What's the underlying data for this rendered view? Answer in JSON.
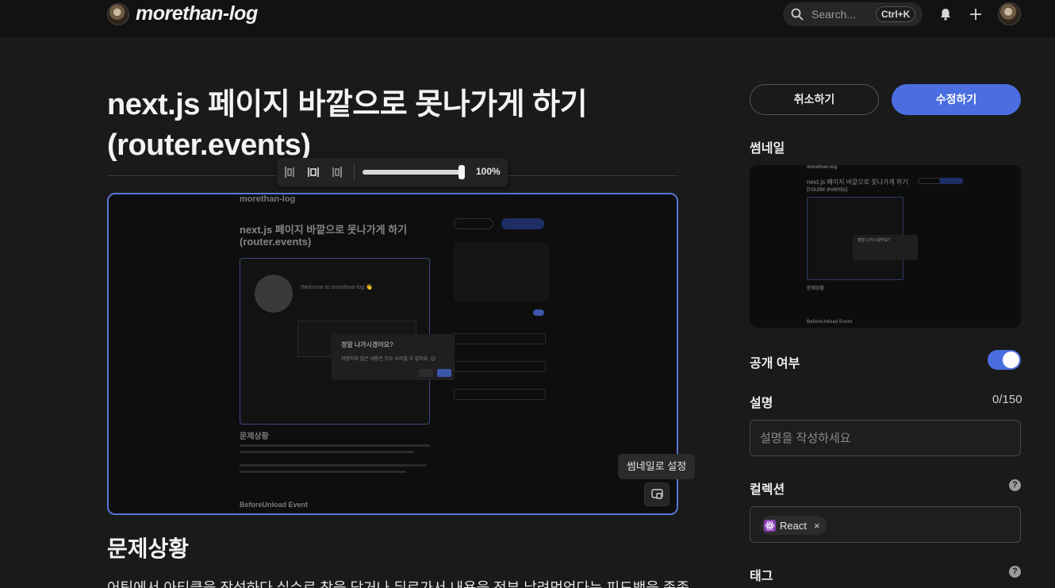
{
  "header": {
    "site_name": "morethan-log",
    "search_placeholder": "Search...",
    "search_shortcut": "Ctrl+K"
  },
  "post": {
    "title": "next.js 페이지 바깥으로 못나가게 하기 (router.events)",
    "section_heading": "문제상황",
    "body_first_line": "어팀에서 아티클을 작성하다 실수로 창을 닫거나 뒤로가서 내용을 전부 날려먹었다는 피드백을 종종"
  },
  "image_toolbar": {
    "zoom_label": "100%",
    "zoom_level": 1.0
  },
  "image_actions": {
    "thumbnail_tooltip": "썸네일로 설정"
  },
  "screenshot_inner": {
    "site_name": "morethan-log",
    "title_line1": "next.js 페이지 바깥으로 못나가게 하기",
    "title_line2": "(router.events)",
    "cancel": "취소하기",
    "edit": "수정하기",
    "dialog_title": "정말 나가시겠어요?",
    "dialog_text": "저장하지 않은 내용은 모두 사라질 수 있어요. 😊",
    "dialog_cancel": "취소",
    "dialog_ok": "확인",
    "section": "문제상황",
    "subsection": "BeforeUnload Event",
    "welcome": "Welcome to morethan-log 👋"
  },
  "sidebar": {
    "cancel_label": "취소하기",
    "edit_label": "수정하기",
    "thumbnail_label": "썸네일",
    "public_label": "공개 여부",
    "public_on": true,
    "description_label": "설명",
    "description_count": "0/150",
    "description_placeholder": "설명을 작성하세요",
    "collection_label": "컬렉션",
    "collection_chip": "React",
    "collection_chip_remove": "×",
    "tag_label": "태그",
    "help_glyph": "?"
  },
  "colors": {
    "accent": "#4a6ee0",
    "background": "#1a1a1a",
    "header": "#121212"
  }
}
